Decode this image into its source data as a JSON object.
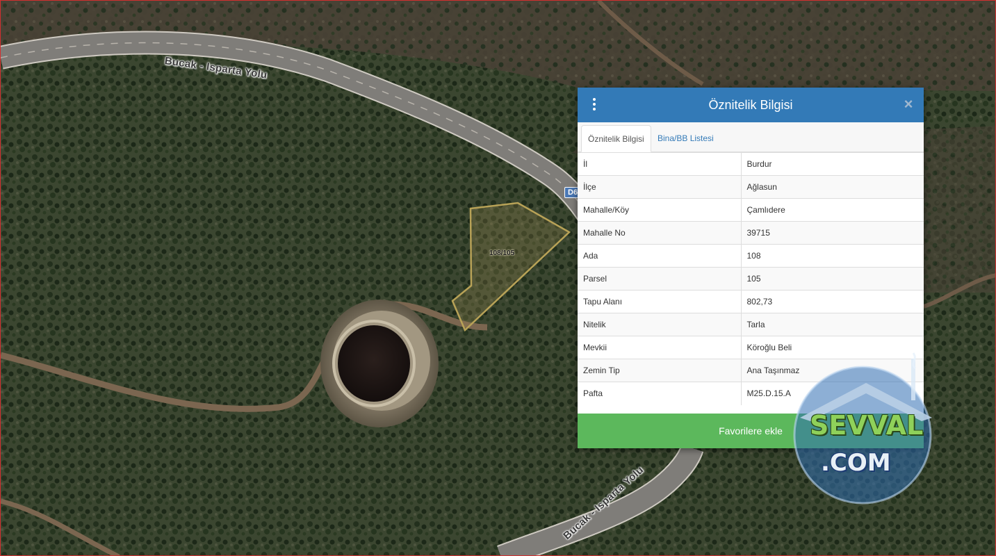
{
  "map": {
    "road_name_top": "Bucak - Isparta Yolu",
    "road_name_bottom": "Bucak - Isparta Yolu",
    "road_shield": "D6",
    "parcel_label": "108/105",
    "parcel_outline_color": "#b8a257",
    "road_color": "#8c8a86",
    "pond_color": "#1f1714"
  },
  "panel": {
    "title": "Öznitelik Bilgisi",
    "menu_icon": "vertical-dots-icon",
    "close_icon": "close-icon",
    "header_color": "#337ab7",
    "tabs": [
      {
        "label": "Öznitelik Bilgisi",
        "active": true
      },
      {
        "label": "Bina/BB Listesi",
        "active": false
      }
    ],
    "rows": [
      {
        "key": "İl",
        "value": "Burdur"
      },
      {
        "key": "İlçe",
        "value": "Ağlasun"
      },
      {
        "key": "Mahalle/Köy",
        "value": "Çamlıdere"
      },
      {
        "key": "Mahalle No",
        "value": "39715"
      },
      {
        "key": "Ada",
        "value": "108"
      },
      {
        "key": "Parsel",
        "value": "105"
      },
      {
        "key": "Tapu Alanı",
        "value": "802,73"
      },
      {
        "key": "Nitelik",
        "value": "Tarla"
      },
      {
        "key": "Mevkii",
        "value": "Köroğlu Beli"
      },
      {
        "key": "Zemin Tip",
        "value": "Ana Taşınmaz"
      },
      {
        "key": "Pafta",
        "value": "M25.D.15.A"
      }
    ],
    "favorite_button": "Favorilere ekle",
    "favorite_color": "#5cb85c"
  },
  "watermark": {
    "main": "SEVVAL",
    "sub": ".COM"
  }
}
